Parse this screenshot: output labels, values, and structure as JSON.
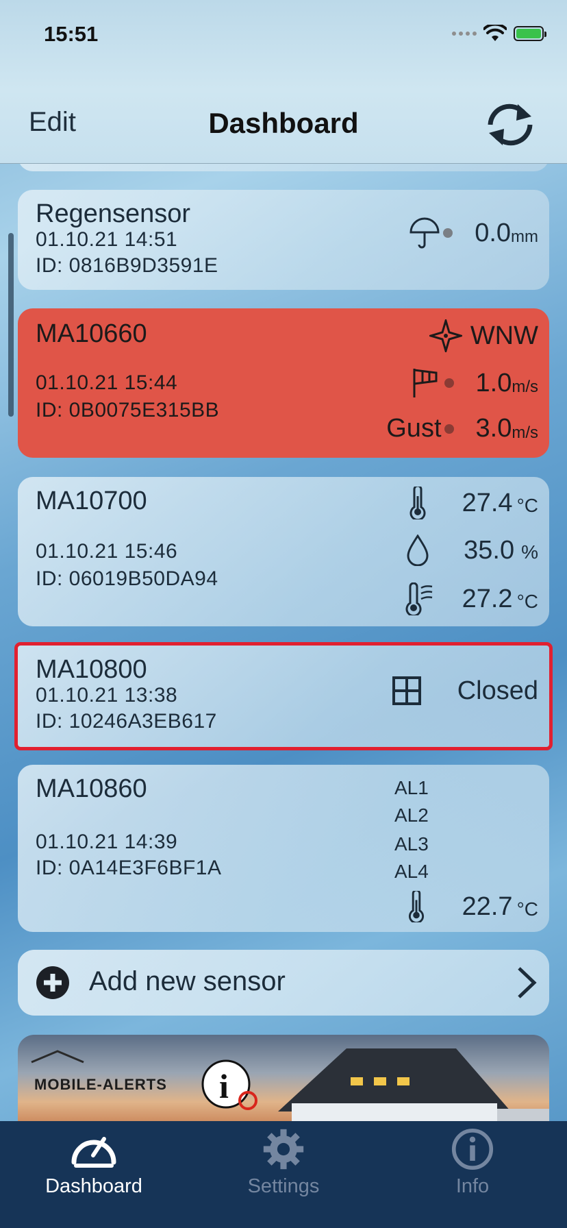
{
  "status_bar": {
    "time": "15:51"
  },
  "nav": {
    "edit_label": "Edit",
    "title": "Dashboard"
  },
  "sensors": [
    {
      "name": "Regensensor",
      "datetime": "01.10.21   14:51",
      "id": "ID: 0816B9D3591E",
      "readings": [
        {
          "icon": "umbrella-icon",
          "value": "0.0",
          "unit": "mm"
        }
      ]
    },
    {
      "name": "MA10660",
      "datetime": "01.10.21   15:44",
      "id": "ID: 0B0075E315BB",
      "status_color": "#e05548",
      "readings": [
        {
          "icon": "compass-icon",
          "value": "WNW",
          "unit": ""
        },
        {
          "icon": "windsock-icon",
          "value": "1.0",
          "unit": "m/s"
        },
        {
          "label": "Gust",
          "value": "3.0",
          "unit": "m/s"
        }
      ]
    },
    {
      "name": "MA10700",
      "datetime": "01.10.21   15:46",
      "id": "ID: 06019B50DA94",
      "readings": [
        {
          "icon": "thermometer-icon",
          "value": "27.4",
          "unit": "°C"
        },
        {
          "icon": "droplet-icon",
          "value": "35.0",
          "unit": "%"
        },
        {
          "icon": "heat-index-icon",
          "value": "27.2",
          "unit": "°C"
        }
      ]
    },
    {
      "name": "MA10800",
      "datetime": "01.10.21   13:38",
      "id": "ID: 10246A3EB617",
      "highlight_color": "#e12030",
      "readings": [
        {
          "icon": "window-icon",
          "value": "Closed",
          "unit": ""
        }
      ]
    },
    {
      "name": "MA10860",
      "datetime": "01.10.21   14:39",
      "id": "ID: 0A14E3F6BF1A",
      "alarms": [
        "AL1",
        "AL2",
        "AL3",
        "AL4"
      ],
      "readings": [
        {
          "icon": "thermometer-icon",
          "value": "22.7",
          "unit": "°C"
        }
      ]
    }
  ],
  "add_sensor": {
    "label": "Add new sensor"
  },
  "banner": {
    "logo": "MOBILE-ALERTS"
  },
  "tabs": [
    {
      "label": "Dashboard",
      "icon": "speedometer-icon",
      "active": true
    },
    {
      "label": "Settings",
      "icon": "gear-icon",
      "active": false
    },
    {
      "label": "Info",
      "icon": "info-icon",
      "active": false
    }
  ]
}
